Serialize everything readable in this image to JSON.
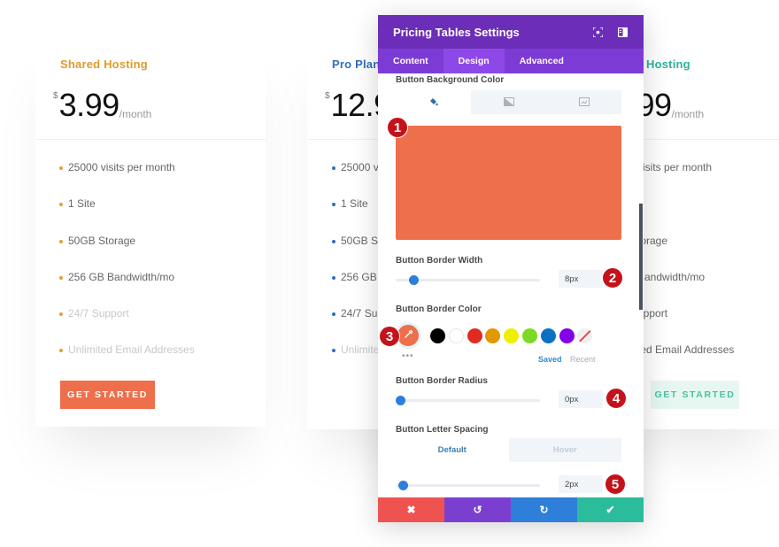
{
  "cards": [
    {
      "title": "Shared Hosting",
      "currency": "$",
      "amount": "3.99",
      "period": "/month",
      "features": [
        "25000 visits per month",
        "1 Site",
        "50GB Storage",
        "256 GB Bandwidth/mo",
        "24/7 Support",
        "Unlimited Email Addresses"
      ],
      "cta": "GET STARTED"
    },
    {
      "title": "Pro Plan",
      "currency": "$",
      "amount": "12.9",
      "features": [
        "25000 vi",
        "1 Site",
        "50GB St",
        "256 GB",
        "24/7 Su",
        "Unlimite"
      ]
    },
    {
      "title": "Hosting",
      "amount": ".99",
      "period": "/month",
      "features": [
        "visits per month",
        "",
        "torage",
        "Bandwidth/mo",
        "upport",
        "ted Email Addresses"
      ],
      "cta": "GET STARTED"
    }
  ],
  "modal": {
    "title": "Pricing Tables Settings",
    "tabs": [
      "Content",
      "Design",
      "Advanced"
    ],
    "active_tab": "Design",
    "sections": {
      "bg_color_label": "Button Background Color",
      "bg_color_value": "#ed6f4c",
      "border_width_label": "Button Border Width",
      "border_width_value": "8px",
      "border_width_fraction": 0.1,
      "border_color_label": "Button Border Color",
      "border_color_swatches": [
        "#000000",
        "#ffffff",
        "#e02b20",
        "#e09900",
        "#edf000",
        "#7cda24",
        "#0c71c3",
        "#8300e9"
      ],
      "saved_label": "Saved",
      "recent_label": "Recent",
      "more_label": "•••",
      "border_radius_label": "Button Border Radius",
      "border_radius_value": "0px",
      "border_radius_fraction": 0,
      "letter_spacing_label": "Button Letter Spacing",
      "letter_spacing_tabs": [
        "Default",
        "Hover"
      ],
      "letter_spacing_value": "2px",
      "letter_spacing_fraction": 0.02
    },
    "badges": [
      "1",
      "2",
      "3",
      "4",
      "5"
    ],
    "footer": {
      "cancel": "✖",
      "undo": "↺",
      "redo": "↻",
      "save": "✔"
    }
  },
  "colors": {
    "accent_purple": "#6c2eb9",
    "orange": "#ed6f4c",
    "cancel_red": "#ef5350",
    "undo_purple": "#7b3fd0",
    "redo_blue": "#2e7fd9",
    "save_green": "#2bbc9c"
  }
}
